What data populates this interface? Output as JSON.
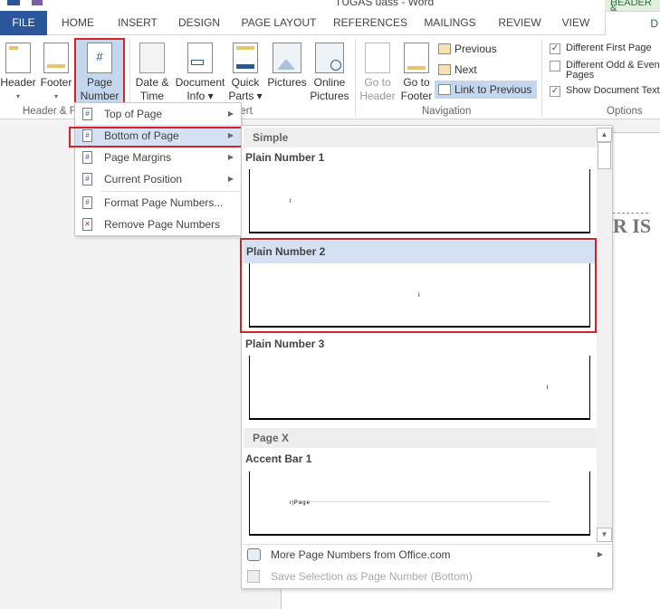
{
  "titlebar": {
    "title": "TUGAS uass - Word",
    "context_tab": "HEADER &"
  },
  "tabs": [
    {
      "label": "FILE"
    },
    {
      "label": "HOME"
    },
    {
      "label": "INSERT"
    },
    {
      "label": "DESIGN"
    },
    {
      "label": "PAGE LAYOUT"
    },
    {
      "label": "REFERENCES"
    },
    {
      "label": "MAILINGS"
    },
    {
      "label": "REVIEW"
    },
    {
      "label": "VIEW"
    },
    {
      "label": "D"
    }
  ],
  "ribbon": {
    "header": {
      "l1": "Header",
      "l2": "▾"
    },
    "footer": {
      "l1": "Footer",
      "l2": "▾"
    },
    "page_number": {
      "l1": "Page",
      "l2": "Number ▾"
    },
    "date_time": {
      "l1": "Date &",
      "l2": "Time"
    },
    "doc_info": {
      "l1": "Document",
      "l2": "Info ▾"
    },
    "quick_parts": {
      "l1": "Quick",
      "l2": "Parts ▾"
    },
    "pictures": {
      "l1": "Pictures"
    },
    "online_pictures": {
      "l1": "Online",
      "l2": "Pictures"
    },
    "goto_header": {
      "l1": "Go to",
      "l2": "Header"
    },
    "goto_footer": {
      "l1": "Go to",
      "l2": "Footer"
    },
    "previous": "Previous",
    "next": "Next",
    "link_previous": "Link to Previous",
    "diff_first": {
      "label": "Different First Page",
      "checked": true
    },
    "diff_odd": {
      "label": "Different Odd & Even Pages",
      "checked": false
    },
    "show_text": {
      "label": "Show Document Text",
      "checked": true
    },
    "groups": {
      "header_footer": "Header & Footer",
      "insert": "Insert",
      "navigation": "Navigation",
      "options": "Options"
    }
  },
  "document": {
    "heading_fragment": "AR IS"
  },
  "menu": {
    "items": [
      {
        "label": "Top of Page",
        "submenu": true
      },
      {
        "label": "Bottom of Page",
        "submenu": true,
        "highlighted": true
      },
      {
        "label": "Page Margins",
        "submenu": true
      },
      {
        "label": "Current Position",
        "submenu": true
      },
      {
        "label": "Format Page Numbers..."
      },
      {
        "label": "Remove Page Numbers"
      }
    ]
  },
  "gallery": {
    "section1": "Simple",
    "item1": "Plain Number 1",
    "item2": "Plain Number 2",
    "item3": "Plain Number 3",
    "section2": "Page X",
    "item4": "Accent Bar 1",
    "preview_num": "i",
    "accent_text": "i|Page",
    "more": "More Page Numbers from Office.com",
    "save": "Save Selection as Page Number (Bottom)"
  },
  "colors": {
    "file_tab": "#2b579a",
    "highlight": "#d5e1f2",
    "red_box": "#d3222a",
    "context_green": "#e3f1da"
  }
}
